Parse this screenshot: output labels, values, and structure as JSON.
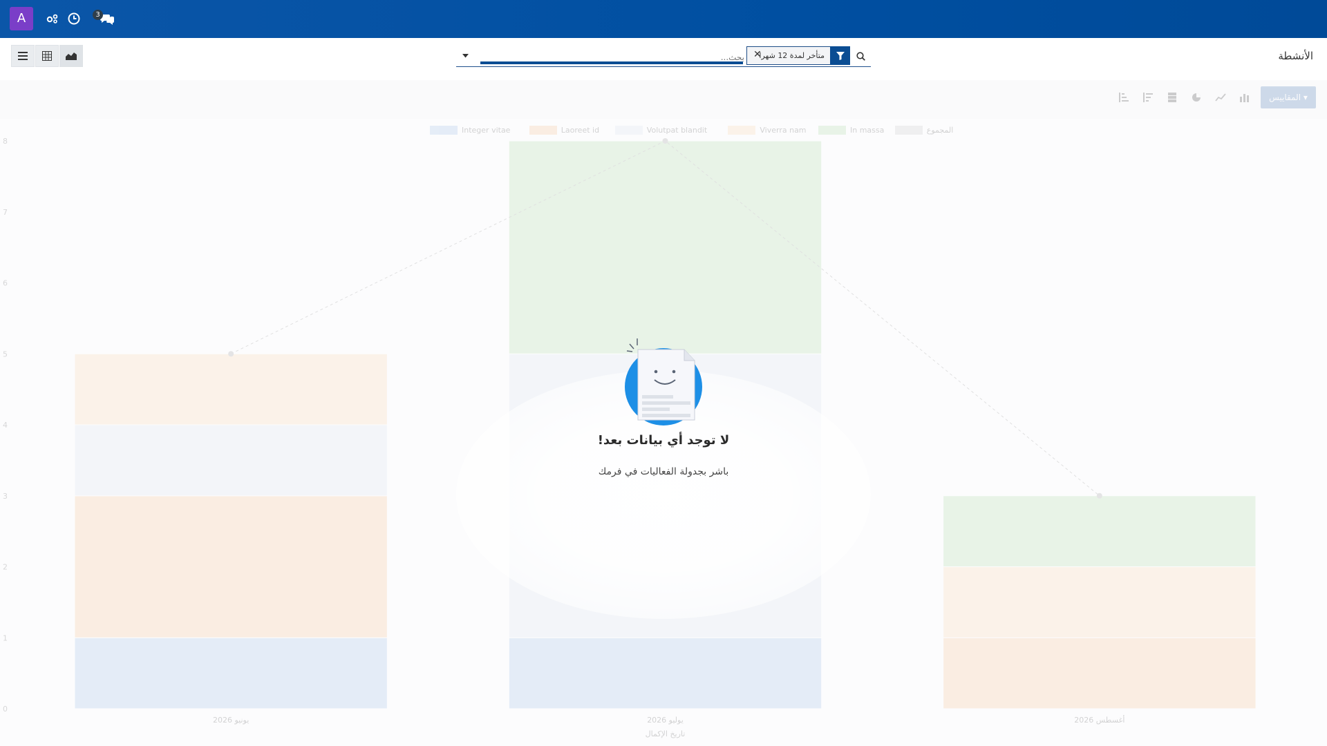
{
  "topbar": {
    "avatar_letter": "A",
    "messages_count": "3",
    "icons": [
      "settings-users-icon",
      "clock-icon",
      "chat-icon"
    ]
  },
  "controlbar": {
    "breadcrumb": "الأنشطة",
    "search": {
      "placeholder": "بحث...",
      "filter_label": "متأخر لمدة 12 شهرا"
    },
    "views": [
      "list-view-icon",
      "pivot-view-icon",
      "graph-view-icon"
    ]
  },
  "graph_toolbar": {
    "measures_label": "المقاييس",
    "tools": [
      "bar-chart-icon",
      "line-chart-icon",
      "pie-chart-icon",
      "stacked-icon",
      "descending-icon",
      "ascending-icon"
    ]
  },
  "chart_data": {
    "type": "bar",
    "stacked": true,
    "title": "",
    "xlabel": "تاريخ الإكمال",
    "ylabel": "",
    "ylim": [
      0,
      8
    ],
    "yticks": [
      "0",
      "1",
      "2",
      "3",
      "4",
      "5",
      "6",
      "7",
      "8"
    ],
    "categories": [
      "يونيو 2026",
      "يوليو 2026",
      "أغسطس 2026"
    ],
    "series": [
      {
        "name": "Integer vitae",
        "color": "#a9c6e8",
        "values": [
          1,
          1,
          0
        ]
      },
      {
        "name": "Laoreet id",
        "color": "#f7c9a0",
        "values": [
          2,
          0,
          1
        ]
      },
      {
        "name": "Volutpat blandit",
        "color": "#dfe5f2",
        "values": [
          1,
          4,
          0
        ]
      },
      {
        "name": "Viverra nam",
        "color": "#f9d9b9",
        "values": [
          1,
          0,
          1
        ]
      },
      {
        "name": "In massa",
        "color": "#b6dfb0",
        "values": [
          0,
          3,
          1
        ]
      }
    ],
    "sum_line": {
      "name": "المجموع",
      "values": [
        5,
        8,
        3
      ]
    },
    "legend_position": "top"
  },
  "empty_state": {
    "title": "لا توجد أي بيانات بعد!",
    "description": "باشر بجدولة الفعاليات في فرمك"
  }
}
